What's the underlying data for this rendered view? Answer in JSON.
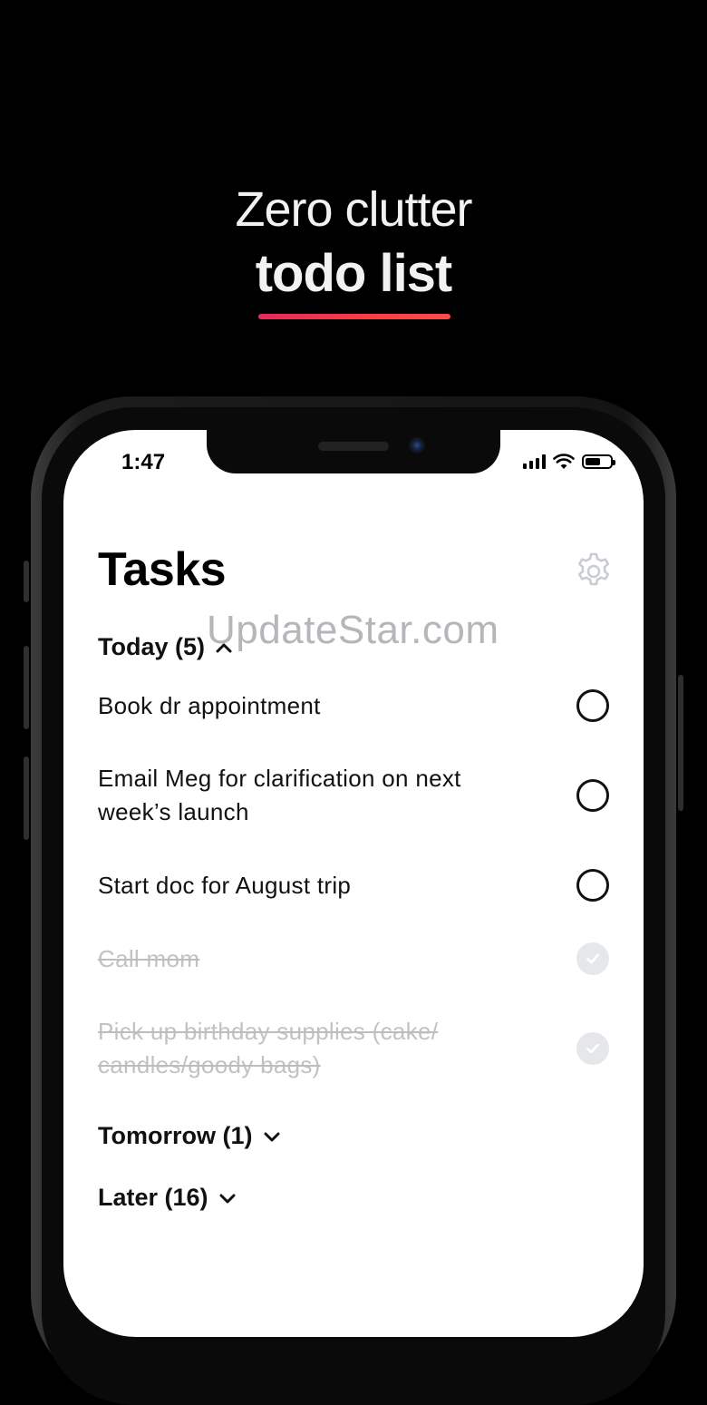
{
  "headline": {
    "line1": "Zero clutter",
    "line2": "todo list"
  },
  "colors": {
    "accent": "#ff3b4e",
    "background": "#000000",
    "checked_circle": "#e6e7eb"
  },
  "status_bar": {
    "time": "1:47",
    "icons": [
      "signal-icon",
      "wifi-icon",
      "battery-icon"
    ]
  },
  "app": {
    "title": "Tasks",
    "settings_icon": "gear-icon",
    "sections": [
      {
        "label": "Today (5)",
        "state": "expanded",
        "chevron": "chevron-up-icon"
      },
      {
        "label": "Tomorrow (1)",
        "state": "collapsed",
        "chevron": "chevron-down-icon"
      },
      {
        "label": "Later (16)",
        "state": "collapsed",
        "chevron": "chevron-down-icon"
      }
    ],
    "tasks": [
      {
        "text": "Book dr appointment",
        "done": false
      },
      {
        "text": "Email Meg for clarification on next week’s launch",
        "done": false
      },
      {
        "text": "Start doc for August trip",
        "done": false
      },
      {
        "text": "Call mom",
        "done": true
      },
      {
        "text": "Pick up birthday supplies (cake/ candles/goody bags)",
        "done": true
      }
    ]
  },
  "watermark": "UpdateStar.com"
}
